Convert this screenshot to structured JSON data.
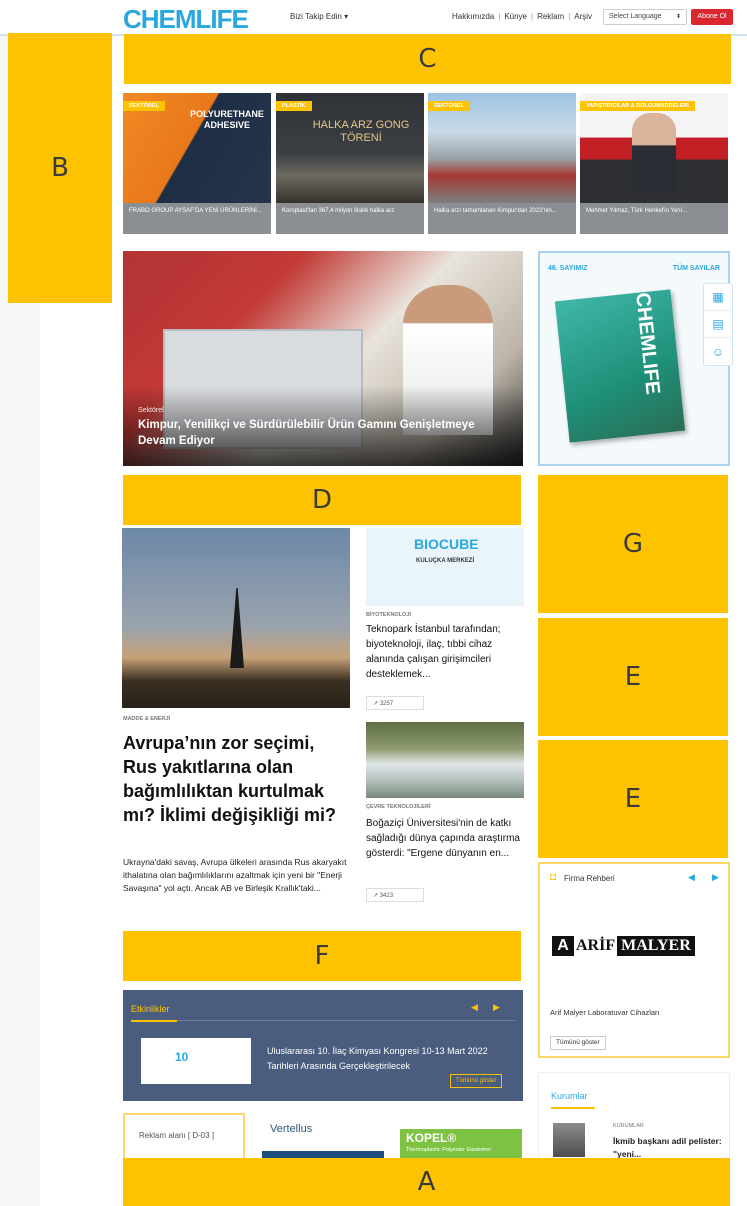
{
  "header": {
    "logo": "CHEMLIFE",
    "follow_label": "Bizi Takip Edin",
    "nav": [
      "Hakkımızda",
      "Künye",
      "Reklam",
      "Arşiv"
    ],
    "language_placeholder": "Select Language",
    "subscribe_label": "Abone Ol"
  },
  "placeholders": {
    "a": "A",
    "b": "B",
    "c": "C",
    "d": "D",
    "e1": "E",
    "e2": "E",
    "f": "F",
    "g": "G"
  },
  "top_cards": [
    {
      "tag": "SEKTÖREL",
      "banner": "POLYURETHANE ADHESIVE",
      "caption": "FRABO GROUP AYSAF'DA YENİ ÜRÜNLERİNİ..."
    },
    {
      "tag": "PLASTİK",
      "banner": "HALKA ARZ GONG TÖRENİ",
      "caption": "Koroplast'tan 367,4 milyon liralık halka arz"
    },
    {
      "tag": "SEKTÖREL",
      "banner": "",
      "caption": "Halka arzı tamamlanan Kimpur'dan 2022'nin..."
    },
    {
      "tag": "YAPIŞTIRICILAR & DOLGUMADDELERİ",
      "banner": "",
      "caption": "Mehmet Yılmaz, Türk Henkel'in Yeni..."
    }
  ],
  "hero": {
    "category": "Sektörel",
    "title": "Kimpur, Yenilikçi ve Sürdürülebilir Ürün Gamını Genişletmeye Devam Ediyor"
  },
  "magazine": {
    "issue_label": "46. SAYIMIZ",
    "all_issues_label": "TÜM SAYILAR",
    "cover_text": "CHEMLIFE"
  },
  "articles": {
    "main": {
      "category": "MADDE & ENERJİ",
      "title": "Avrupa’nın zor seçimi, Rus yakıtlarına olan bağımlılıktan kurtulmak mı? İklimi değişikliği mi?",
      "excerpt": "Ukrayna'daki savaş, Avrupa ülkeleri arasında Rus akaryakıt ithalatına olan bağımlılıklarını azaltmak için yeni bir \"Enerji Savaşına\" yol açtı. Ancak AB ve Birleşik Krallık'taki..."
    },
    "second": {
      "image_title": "BIOCUBE",
      "image_sub": "KULUÇKA MERKEZİ",
      "category": "BİYOTEKNOLOJİ",
      "title": "Teknopark İstanbul tarafından; biyoteknoloji, ilaç, tıbbi cihaz alanında çalışan girişimcileri desteklemek...",
      "views": "3257"
    },
    "third": {
      "category": "ÇEVRE TEKNOLOJİLERİ",
      "title": "Boğaziçi Üniversitesi'nin de katkı sağladığı dünya çapında araştırma gösterdi: \"Ergene dünyanın en...",
      "views": "3423"
    }
  },
  "firm_guide": {
    "title": "Firma Rehberi",
    "brand_a": "A",
    "brand_arif": "ARİF",
    "brand_malyer": "MALYER",
    "company": "Arif Malyer Laboratuvar Cihazları",
    "more_label": "Tümünü göster"
  },
  "events": {
    "label": "Etkinlikler",
    "thumb_text": "10",
    "text": "Uluslararası 10. İlaç Kimyası Kongresi 10-13 Mart 2022 Tarihleri Arasında Gerçekleştirilecek",
    "all_label": "Tümünü göster"
  },
  "ads": {
    "slot": "Reklam alanı [ D-03 ]",
    "vertellus": "Vertellus",
    "kopel": "KOPEL®",
    "kopel_sub": "Thermoplastic Polyester Elastomer"
  },
  "institutions": {
    "title": "Kurumlar",
    "category": "KURUMLAR",
    "headline": "İkmib başkanı adil pelister: \"yeni..."
  },
  "colors": {
    "accent": "#29a7df",
    "overlay": "#fdc300",
    "subscribe": "#d9262f",
    "events_bg": "#4a5d7e"
  }
}
